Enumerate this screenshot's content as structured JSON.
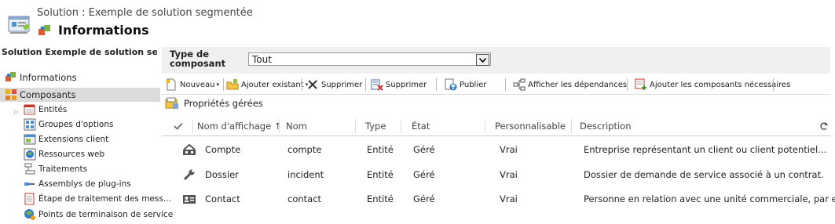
{
  "header": {
    "subtitle": "Solution : Exemple de solution segmentée",
    "title": "Informations"
  },
  "sidebar": {
    "title": "Solution Exemple de solution segm...",
    "items": [
      {
        "label": "Informations",
        "icon": "puzzle-icon"
      },
      {
        "label": "Composants",
        "icon": "components-icon",
        "selected": true
      }
    ],
    "subitems": [
      {
        "label": "Entités",
        "icon": "entities-icon"
      },
      {
        "label": "Groupes d'options",
        "icon": "option-sets-icon"
      },
      {
        "label": "Extensions client",
        "icon": "client-extensions-icon"
      },
      {
        "label": "Ressources web",
        "icon": "web-resources-icon"
      },
      {
        "label": "Traitements",
        "icon": "processes-icon"
      },
      {
        "label": "Assemblys de plug-ins",
        "icon": "plugin-assemblies-icon"
      },
      {
        "label": "Étape de traitement des mess...",
        "icon": "message-step-icon"
      },
      {
        "label": "Points de terminaison de service",
        "icon": "service-endpoints-icon"
      }
    ]
  },
  "filter": {
    "label": "Type de composant",
    "value": "Tout"
  },
  "toolbar": {
    "new": "Nouveau",
    "add_existing": "Ajouter existant",
    "delete1": "Supprimer",
    "delete2": "Supprimer",
    "publish": "Publier",
    "show_deps": "Afficher les dépendances",
    "add_required": "Ajouter les composants nécessaires",
    "managed_props": "Propriétés gérées"
  },
  "table": {
    "columns": [
      "Nom d'affichage ↑",
      "Nom",
      "Type",
      "État",
      "Personnalisable",
      "Description"
    ],
    "rows": [
      {
        "icon": "account-icon",
        "display": "Compte",
        "name": "compte",
        "type": "Entité",
        "state": "Géré",
        "custom": "Vrai",
        "desc": "Entreprise représentant un client ou client potentiel..."
      },
      {
        "icon": "wrench-icon",
        "display": "Dossier",
        "name": "incident",
        "type": "Entité",
        "state": "Géré",
        "custom": "Vrai",
        "desc": "Dossier de demande de service associé à un contrat."
      },
      {
        "icon": "contact-card-icon",
        "display": "Contact",
        "name": "contact",
        "type": "Entité",
        "state": "Géré",
        "custom": "Vrai",
        "desc": "Personne en relation avec une unité commerciale, par ex..."
      }
    ]
  },
  "colors": {
    "selected_bg": "#dcdcdc",
    "filter_bg": "#f0f0f0"
  }
}
